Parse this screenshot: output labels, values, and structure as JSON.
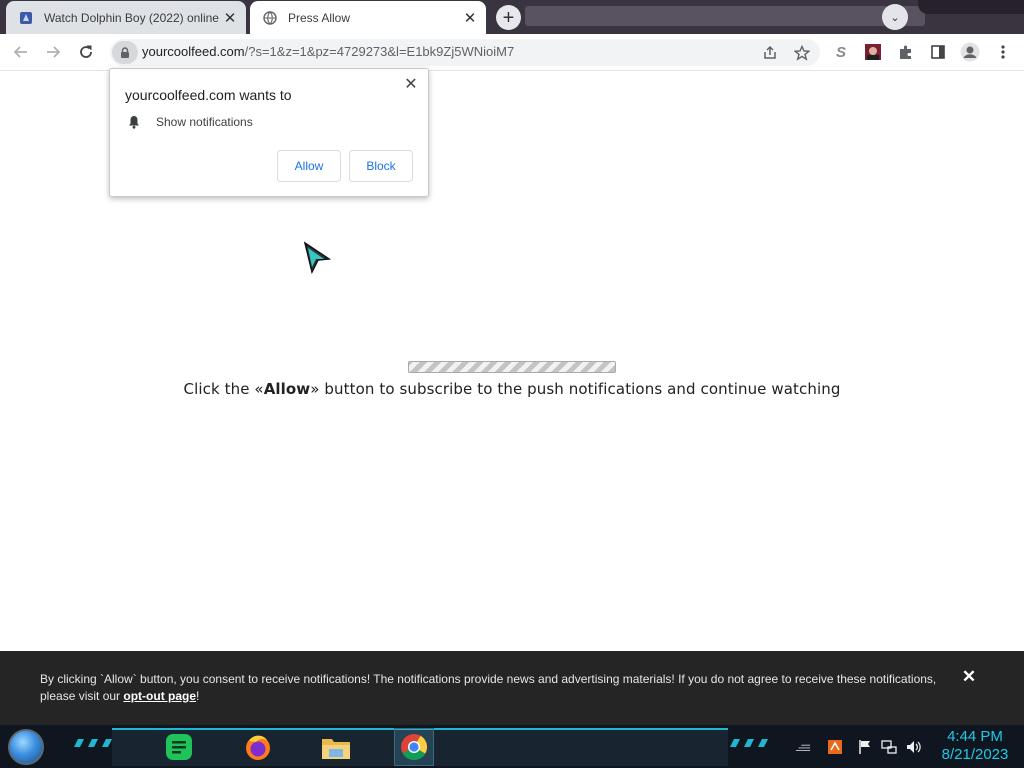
{
  "browser": {
    "tabs": [
      {
        "title": "Watch Dolphin Boy (2022) online",
        "close": "✕"
      },
      {
        "title": "Press Allow",
        "close": "✕"
      }
    ],
    "new_tab": "+",
    "tab_search": "⌄",
    "url_host": "yourcoolfeed.com",
    "url_path": "/?s=1&z=1&pz=4729273&l=E1bk9Zj5WNioiM7"
  },
  "permission_prompt": {
    "title": "yourcoolfeed.com wants to",
    "permission": "Show notifications",
    "close": "✕",
    "allow_label": "Allow",
    "block_label": "Block"
  },
  "page": {
    "message_before": "Click the «",
    "message_bold": "Allow",
    "message_after": "» button to subscribe to the push notifications and continue watching",
    "progress_level": 1.0
  },
  "banner": {
    "text": "By clicking `Allow` button, you consent to receive notifications! The notifications provide news and advertising materials! If you do not agree to receive these notifications, please visit our ",
    "link_text": "opt-out page",
    "text_end": "!",
    "close": "✕"
  },
  "taskbar": {
    "apps": [
      "notes-app-icon",
      "firefox-icon",
      "file-explorer-icon",
      "chrome-icon"
    ],
    "time": "4:44 PM",
    "date": "8/21/2023"
  },
  "colors": {
    "tabstrip": "#3a3340",
    "banner": "#252525",
    "clock": "#1fc8e8",
    "link_blue": "#1a73e8"
  }
}
